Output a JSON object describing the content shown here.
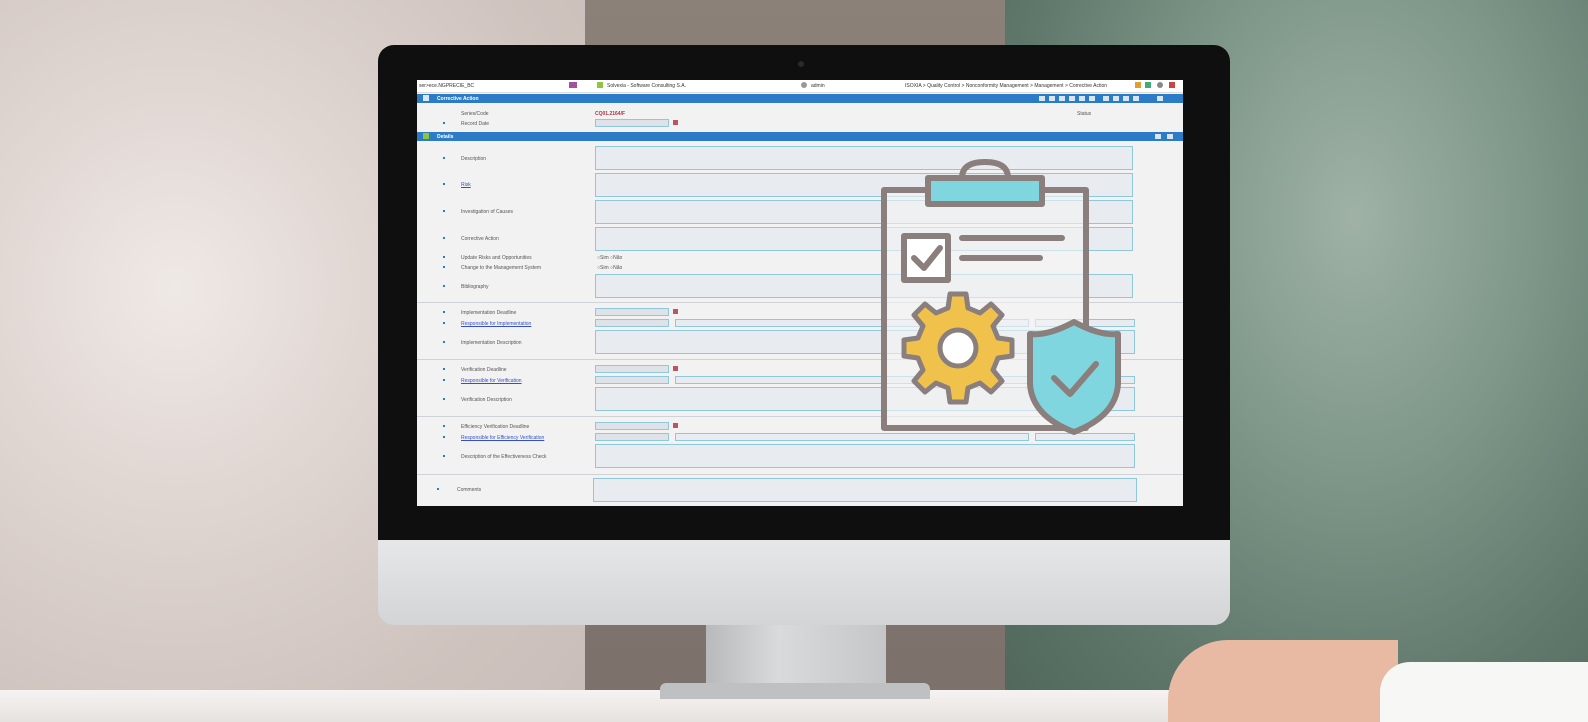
{
  "window": {
    "left_title": "ser>ece.NGPRECIE_BC",
    "company": "Solvexia - Software Consulting S.A.",
    "breadcrumb": "ISOXIA > Quality Control > Nonconformity Management > Management > Corrective Action",
    "user": "admin"
  },
  "section_ca": {
    "title": "Corrective Action",
    "fields": {
      "series_code_label": "Series/Code",
      "series_code_value": "CQ01.2164/F",
      "record_date_label": "Record Date",
      "status_label": "Status"
    }
  },
  "section_details": {
    "title": "Details",
    "rows": [
      {
        "label": "Description"
      },
      {
        "label": "Risk"
      },
      {
        "label": "Investigation of Causes"
      },
      {
        "label": "Corrective Action"
      }
    ],
    "update_risks_label": "Update Risks and Opportunities",
    "change_ms_label": "Change to the Management System",
    "yes_label": "Sim",
    "no_label": "Não",
    "bibliography_label": "Bibliography",
    "impl_deadline_label": "Implementation Deadline",
    "impl_responsible_label": "Responsible for Implementation",
    "impl_description_label": "Implementation Description",
    "verif_deadline_label": "Verification Deadline",
    "verif_responsible_label": "Responsible for Verification",
    "verif_description_label": "Verification Description",
    "eff_deadline_label": "Efficiency Verification Deadline",
    "eff_responsible_label": "Responsible for Efficiency Verification",
    "eff_description_label": "Description of the Effectiveness Check",
    "comments_label": "Comments"
  },
  "overlay_icon": "clipboard-gear-shield-icon",
  "colors": {
    "accent": "#2b7bc7",
    "icon_teal": "#7fd6df",
    "icon_gear": "#f0c24c",
    "icon_stroke": "#8a7f7d"
  }
}
